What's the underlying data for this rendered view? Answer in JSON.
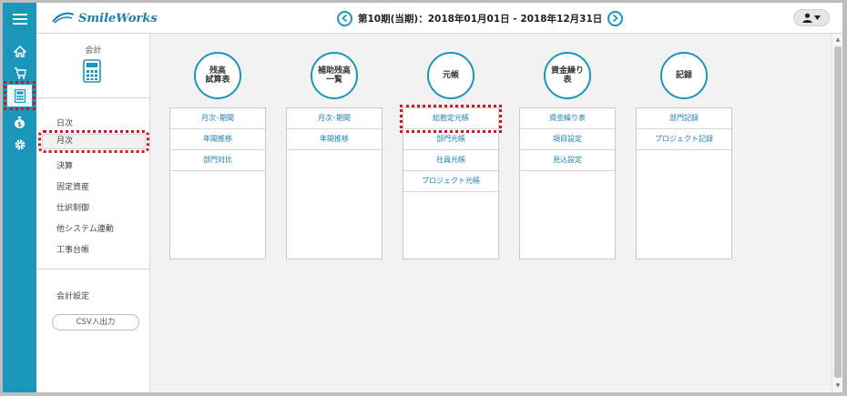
{
  "app": {
    "logo_text": "SmileWorks"
  },
  "header": {
    "period_label": "第10期(当期)：2018年01月01日 - 2018年12月31日"
  },
  "rail": {
    "items": [
      "menu-icon",
      "home-icon",
      "cart-icon",
      "calculator-icon",
      "money-bag-icon",
      "gear-icon"
    ]
  },
  "sidemenu": {
    "title": "会計",
    "items": [
      "日次",
      "月次",
      "決算",
      "固定資産",
      "仕訳制御",
      "他システム連動",
      "工事台帳"
    ],
    "settings": "会計設定",
    "csv_button": "CSV入出力"
  },
  "columns": [
    {
      "head_lines": [
        "残高",
        "試算表"
      ],
      "rows": [
        "月次･期間",
        "年間推移",
        "部門対比"
      ]
    },
    {
      "head_lines": [
        "補助残高",
        "一覧"
      ],
      "rows": [
        "月次･期間",
        "年間推移"
      ]
    },
    {
      "head_lines": [
        "元帳"
      ],
      "rows": [
        "総勘定元帳",
        "部門元帳",
        "社員元帳",
        "プロジェクト元帳"
      ]
    },
    {
      "head_lines": [
        "資金繰り",
        "表"
      ],
      "rows": [
        "資金繰り表",
        "項目設定",
        "見込設定"
      ]
    },
    {
      "head_lines": [
        "記録"
      ],
      "rows": [
        "部門記録",
        "プロジェクト記録"
      ]
    }
  ],
  "colors": {
    "accent": "#1a96ba",
    "highlight": "#d7141a"
  }
}
